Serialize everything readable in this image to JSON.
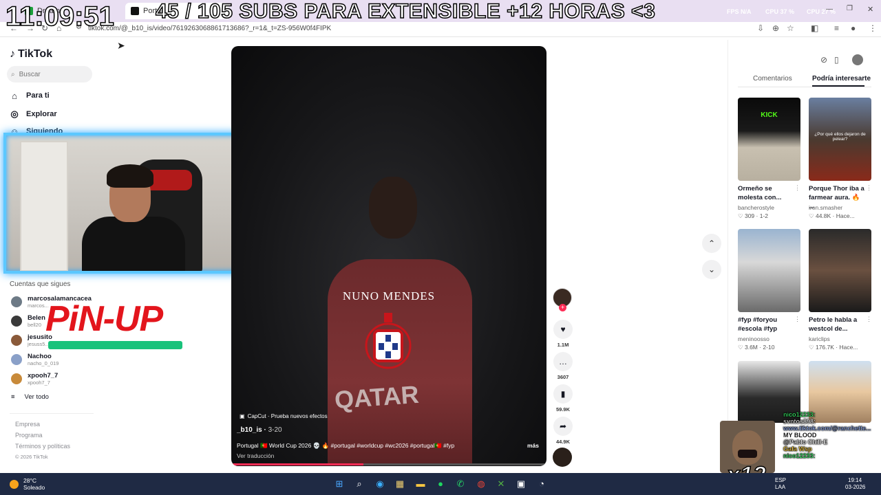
{
  "stream_overlay": {
    "clock": "11:09:51",
    "headline": "45 / 105 SUBS PARA EXTENSIBLE +12 HORAS <3",
    "fps": "FPS N/A",
    "cpu1": "CPU 37 %",
    "cpu2": "CPU 27 %",
    "sponsor": "PiN-UP"
  },
  "browser": {
    "tab_first_label": "Dream",
    "tab_active_label": "Portug",
    "url": "tiktok.com/@_b10_is/video/7619263068861713686?_r=1&_t=ZS-956W0f4FIPK"
  },
  "sidebar": {
    "logo": "TikTok",
    "search_placeholder": "Buscar",
    "nav": [
      {
        "label": "Para ti"
      },
      {
        "label": "Explorar"
      },
      {
        "label": "Siguiendo"
      }
    ],
    "following_title": "Cuentas que sigues",
    "following": [
      {
        "name": "marcosalamancacea",
        "handle": "marcos..."
      },
      {
        "name": "Belen",
        "handle": "bell20"
      },
      {
        "name": "jesusito",
        "handle": "jesuss5..."
      },
      {
        "name": "Nachoo",
        "handle": "nacho_0_019"
      },
      {
        "name": "xpooh7_7",
        "handle": "xpooh7_7"
      }
    ],
    "see_all": "Ver todo",
    "footer": [
      "Empresa",
      "Programa",
      "Términos y políticas",
      "© 2026 TikTok"
    ]
  },
  "video": {
    "player_name": "NUNO MENDES",
    "sponsor_text": "QATAR",
    "capcut": "CapCut · Prueba nuevos efectos",
    "author": "_b10_is",
    "date": "3-20",
    "caption": "Portugal 🇵🇹 World Cup 2026 💀 🔥 #portugal #worldcup #wc2026 #portugal🇵🇹 #fyp",
    "translate": "Ver traducción",
    "more": "más",
    "progress": 0.42
  },
  "actions": {
    "likes": "1.1M",
    "comments": "3607",
    "saves": "59.9K",
    "shares": "44.9K"
  },
  "right_panel": {
    "tab_comments": "Comentarios",
    "tab_foryou": "Podría interesarte",
    "items": [
      {
        "title": "Ormeño se molesta con...",
        "author": "bancherostyle",
        "meta": "♡ 309 · 1-2"
      },
      {
        "title": "Porque Thor iba a farmear aura. 🔥 ...",
        "author": "iron.smasher",
        "meta": "♡ 44.8K · Hace..."
      },
      {
        "title": "#fyp #foryou #escola #fyp",
        "author": "meninoosso",
        "meta": "♡ 3.6M · 2-10"
      },
      {
        "title": "Petro le habla a westcol de...",
        "author": "kariclips",
        "meta": "♡ 176.7K · Hace..."
      }
    ],
    "thumb_texts": [
      "KICK",
      "¿Por qué ellos dejaron de pelear?"
    ]
  },
  "chat": {
    "lines": [
      "nico12233:",
      "svntos898:",
      "www.tiktok.com/@ranchette...",
      "MY BLOOD",
      "@Pablo Chill-E",
      "Gafa Wsp",
      "nico12233:"
    ],
    "badge": "x12"
  },
  "taskbar": {
    "temp": "28°C",
    "condition": "Soleado",
    "lang1": "ESP",
    "lang2": "LAA",
    "time": "19:14",
    "date": "03-2026"
  }
}
